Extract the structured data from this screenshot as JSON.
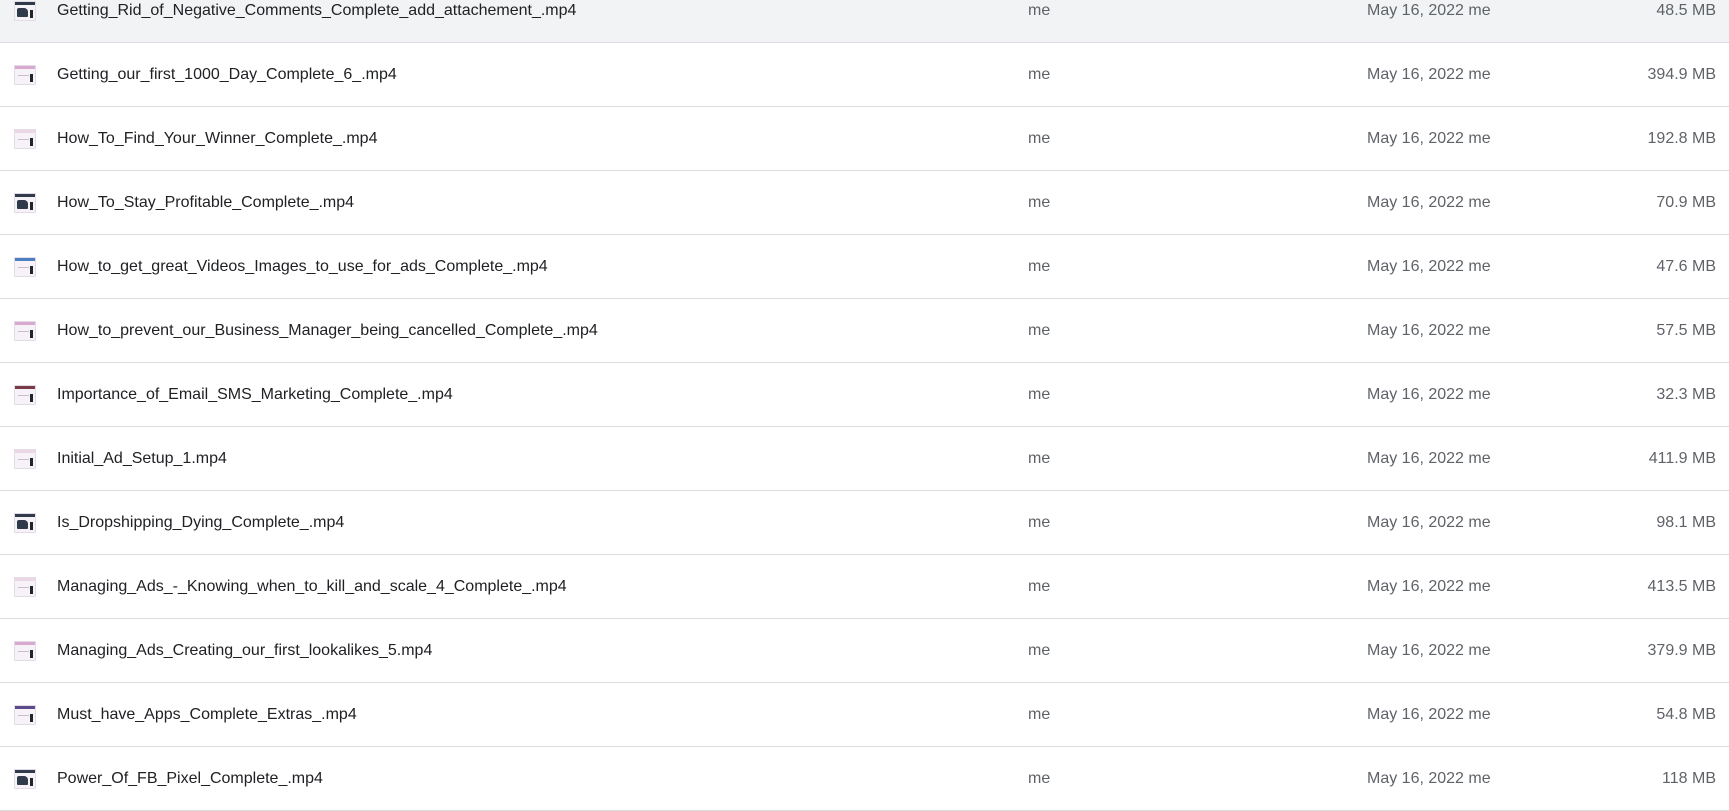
{
  "files": [
    {
      "name": "Getting_Rid_of_Negative_Comments_Complete_add_attachement_.mp4",
      "owner": "me",
      "modified": "May 16, 2022 me",
      "size": "48.5 MB",
      "thumb": "dark",
      "thumb_icon": "video-thumbnail-icon"
    },
    {
      "name": "Getting_our_first_1000_Day_Complete_6_.mp4",
      "owner": "me",
      "modified": "May 16, 2022 me",
      "size": "394.9 MB",
      "thumb": "pink",
      "thumb_icon": "video-thumbnail-icon"
    },
    {
      "name": "How_To_Find_Your_Winner_Complete_.mp4",
      "owner": "me",
      "modified": "May 16, 2022 me",
      "size": "192.8 MB",
      "thumb": "pale",
      "thumb_icon": "video-thumbnail-icon"
    },
    {
      "name": "How_To_Stay_Profitable_Complete_.mp4",
      "owner": "me",
      "modified": "May 16, 2022 me",
      "size": "70.9 MB",
      "thumb": "dark",
      "thumb_icon": "video-thumbnail-icon"
    },
    {
      "name": "How_to_get_great_Videos_Images_to_use_for_ads_Complete_.mp4",
      "owner": "me",
      "modified": "May 16, 2022 me",
      "size": "47.6 MB",
      "thumb": "blue",
      "thumb_icon": "video-thumbnail-icon"
    },
    {
      "name": "How_to_prevent_our_Business_Manager_being_cancelled_Complete_.mp4",
      "owner": "me",
      "modified": "May 16, 2022 me",
      "size": "57.5 MB",
      "thumb": "pink",
      "thumb_icon": "video-thumbnail-icon"
    },
    {
      "name": "Importance_of_Email_SMS_Marketing_Complete_.mp4",
      "owner": "me",
      "modified": "May 16, 2022 me",
      "size": "32.3 MB",
      "thumb": "red",
      "thumb_icon": "video-thumbnail-icon"
    },
    {
      "name": "Initial_Ad_Setup_1.mp4",
      "owner": "me",
      "modified": "May 16, 2022 me",
      "size": "411.9 MB",
      "thumb": "pale",
      "thumb_icon": "video-thumbnail-icon"
    },
    {
      "name": "Is_Dropshipping_Dying_Complete_.mp4",
      "owner": "me",
      "modified": "May 16, 2022 me",
      "size": "98.1 MB",
      "thumb": "dark",
      "thumb_icon": "video-thumbnail-icon"
    },
    {
      "name": "Managing_Ads_-_Knowing_when_to_kill_and_scale_4_Complete_.mp4",
      "owner": "me",
      "modified": "May 16, 2022 me",
      "size": "413.5 MB",
      "thumb": "pale",
      "thumb_icon": "video-thumbnail-icon"
    },
    {
      "name": "Managing_Ads_Creating_our_first_lookalikes_5.mp4",
      "owner": "me",
      "modified": "May 16, 2022 me",
      "size": "379.9 MB",
      "thumb": "pink",
      "thumb_icon": "video-thumbnail-icon"
    },
    {
      "name": "Must_have_Apps_Complete_Extras_.mp4",
      "owner": "me",
      "modified": "May 16, 2022 me",
      "size": "54.8 MB",
      "thumb": "purple",
      "thumb_icon": "video-thumbnail-icon"
    },
    {
      "name": "Power_Of_FB_Pixel_Complete_.mp4",
      "owner": "me",
      "modified": "May 16, 2022 me",
      "size": "118 MB",
      "thumb": "dark",
      "thumb_icon": "video-thumbnail-icon"
    }
  ],
  "thumb_colors": {
    "dark": "#2f3a4a",
    "pink": "#d9a8cf",
    "pale": "#ead8e6",
    "blue": "#4a7fc1",
    "red": "#7a3b48",
    "purple": "#5b4b8a"
  }
}
